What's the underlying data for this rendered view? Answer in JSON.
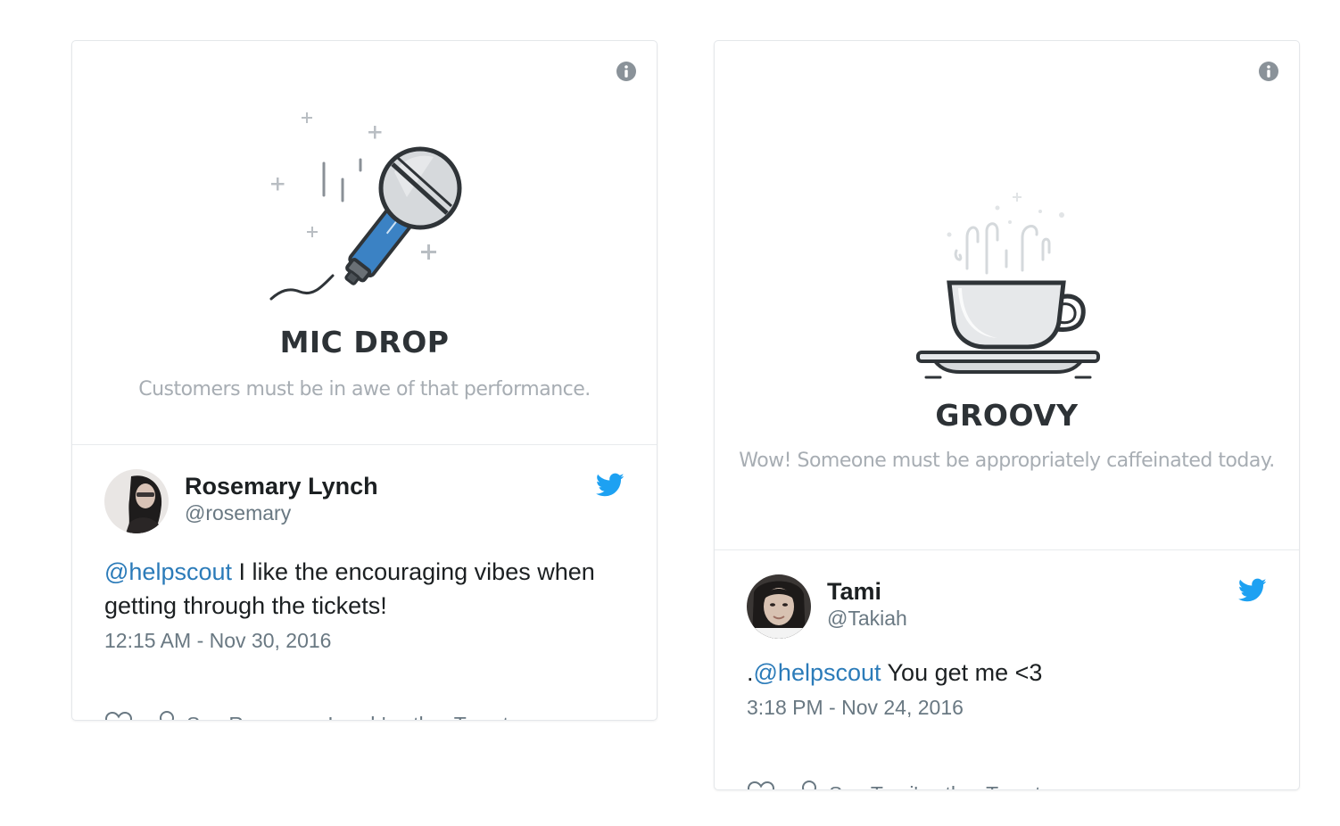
{
  "cards": [
    {
      "promo": {
        "title": "MIC DROP",
        "subtitle": "Customers must be in awe of that performance."
      },
      "tweet": {
        "author_name": "Rosemary Lynch",
        "author_handle": "@rosemary",
        "mention": "@helpscout",
        "text": " I like the encouraging vibes when getting through the tickets!",
        "text_prefix": "",
        "timestamp": "12:15 AM - Nov 30, 2016",
        "see_other_label": "See Rosemary Lynch's other Tweets"
      }
    },
    {
      "promo": {
        "title": "GROOVY",
        "subtitle": "Wow! Someone must be appropriately caffeinated today."
      },
      "tweet": {
        "author_name": "Tami",
        "author_handle": "@Takiah",
        "text_prefix": ".",
        "mention": "@helpscout",
        "text": " You get me <3",
        "timestamp": "3:18 PM - Nov 24, 2016",
        "see_other_label": "See Tami's other Tweets"
      }
    }
  ],
  "colors": {
    "twitter_blue": "#1da1f2",
    "mention_blue": "#2b7bb9",
    "mic_blue": "#3b82c4",
    "muted_text": "#697882",
    "subtitle_gray": "#a7adb3"
  },
  "icons": [
    "info-icon",
    "microphone-illustration",
    "coffee-cup-illustration",
    "twitter-bird-icon",
    "heart-icon",
    "person-icon"
  ]
}
